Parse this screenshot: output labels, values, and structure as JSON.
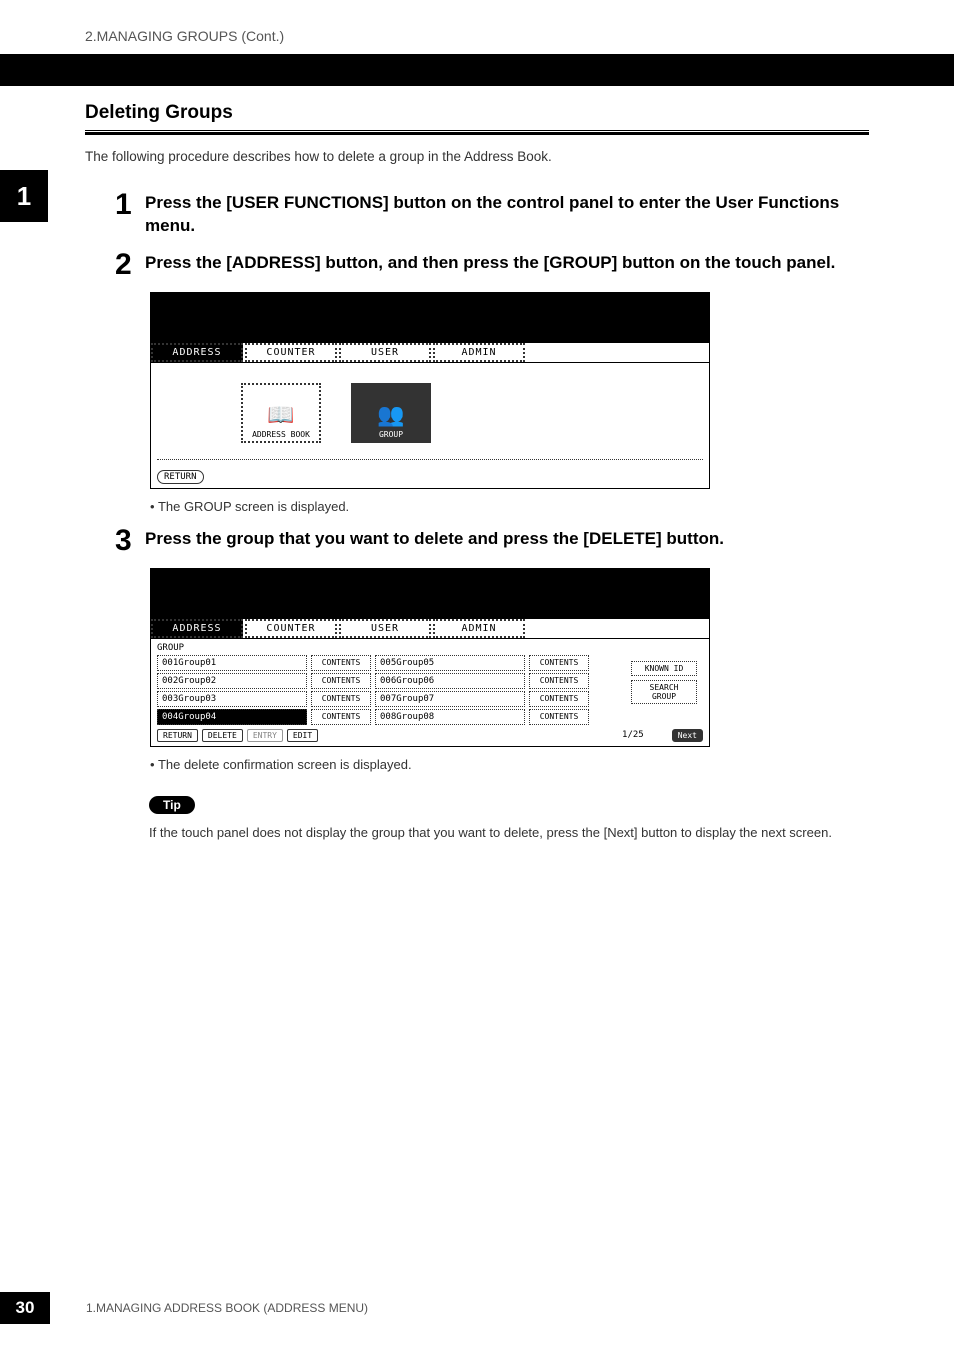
{
  "breadcrumb": "2.MANAGING GROUPS (Cont.)",
  "chapter_tab": "1",
  "section_title": "Deleting Groups",
  "intro": "The following procedure describes how to delete a group in the Address Book.",
  "steps": [
    {
      "num": "1",
      "text": "Press the [USER FUNCTIONS] button on the control panel to enter the User Functions menu."
    },
    {
      "num": "2",
      "text": "Press the [ADDRESS] button, and then press the [GROUP] button on the touch panel."
    },
    {
      "num": "3",
      "text": "Press the group that you want to delete and press the [DELETE] button."
    }
  ],
  "screenshot1": {
    "tabs": [
      "ADDRESS",
      "COUNTER",
      "USER",
      "ADMIN"
    ],
    "active_tab": "ADDRESS",
    "icons": [
      {
        "label": "ADDRESS BOOK",
        "active": false
      },
      {
        "label": "GROUP",
        "active": true
      }
    ],
    "return_label": "RETURN"
  },
  "bullet1": "The GROUP screen is displayed.",
  "screenshot2": {
    "tabs": [
      "ADDRESS",
      "COUNTER",
      "USER",
      "ADMIN"
    ],
    "active_tab": "ADDRESS",
    "group_label": "GROUP",
    "groups_left": [
      {
        "id": "001",
        "name": "Group01",
        "selected": false
      },
      {
        "id": "002",
        "name": "Group02",
        "selected": false
      },
      {
        "id": "003",
        "name": "Group03",
        "selected": false
      },
      {
        "id": "004",
        "name": "Group04",
        "selected": true
      }
    ],
    "groups_right": [
      {
        "id": "005",
        "name": "Group05"
      },
      {
        "id": "006",
        "name": "Group06"
      },
      {
        "id": "007",
        "name": "Group07"
      },
      {
        "id": "008",
        "name": "Group08"
      }
    ],
    "contents_label": "CONTENTS",
    "side_buttons": [
      "KNOWN ID",
      "SEARCH GROUP"
    ],
    "bottom_buttons": [
      "RETURN",
      "DELETE",
      "ENTRY",
      "EDIT"
    ],
    "page_indicator": "1/25",
    "next_label": "Next"
  },
  "bullet2": "The delete confirmation screen is displayed.",
  "tip_label": "Tip",
  "tip_text": "If the touch panel does not display the group that you want to delete, press the [Next] button to display the next screen.",
  "footer": {
    "page_num": "30",
    "text": "1.MANAGING ADDRESS BOOK (ADDRESS MENU)"
  }
}
